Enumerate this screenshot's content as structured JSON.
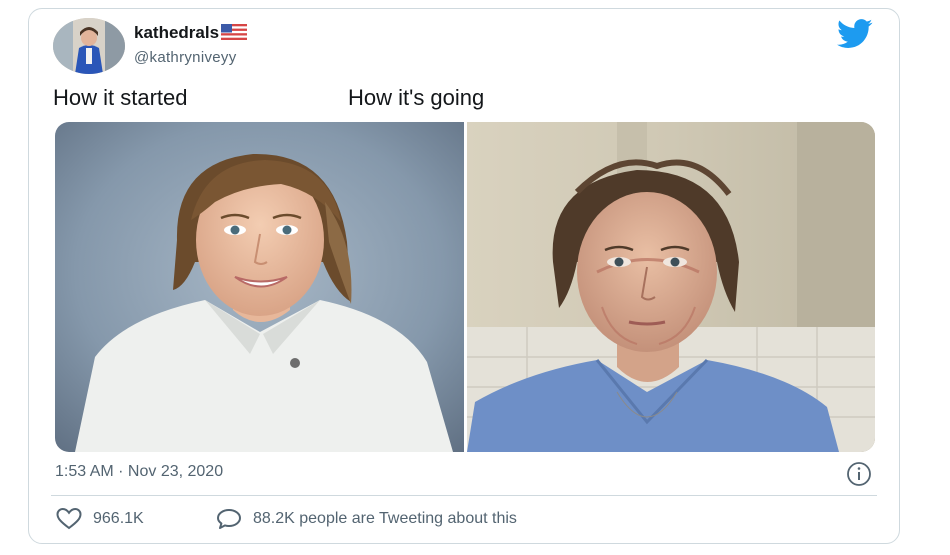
{
  "tweet": {
    "author": {
      "display_name": "kathedrals",
      "handle": "@kathryniveyy",
      "avatar": "profile-photo",
      "flag_icon": "us-flag-icon"
    },
    "platform_icon": "twitter-bird-icon",
    "captions": {
      "left": "How it started",
      "right": "How it's going"
    },
    "photos": [
      {
        "name": "portrait-photo",
        "position": "left"
      },
      {
        "name": "hospital-selfie-photo",
        "position": "right"
      }
    ],
    "timestamp": "1:53 AM · Nov 23, 2020",
    "info_icon": "info-icon",
    "metrics": {
      "likes": "966.1K",
      "tweeting_about": "88.2K people are Tweeting about this"
    }
  },
  "colors": {
    "twitter_blue": "#1d9bf0",
    "text_primary": "#14171a",
    "text_secondary": "#536471",
    "border": "#cfd9de"
  }
}
